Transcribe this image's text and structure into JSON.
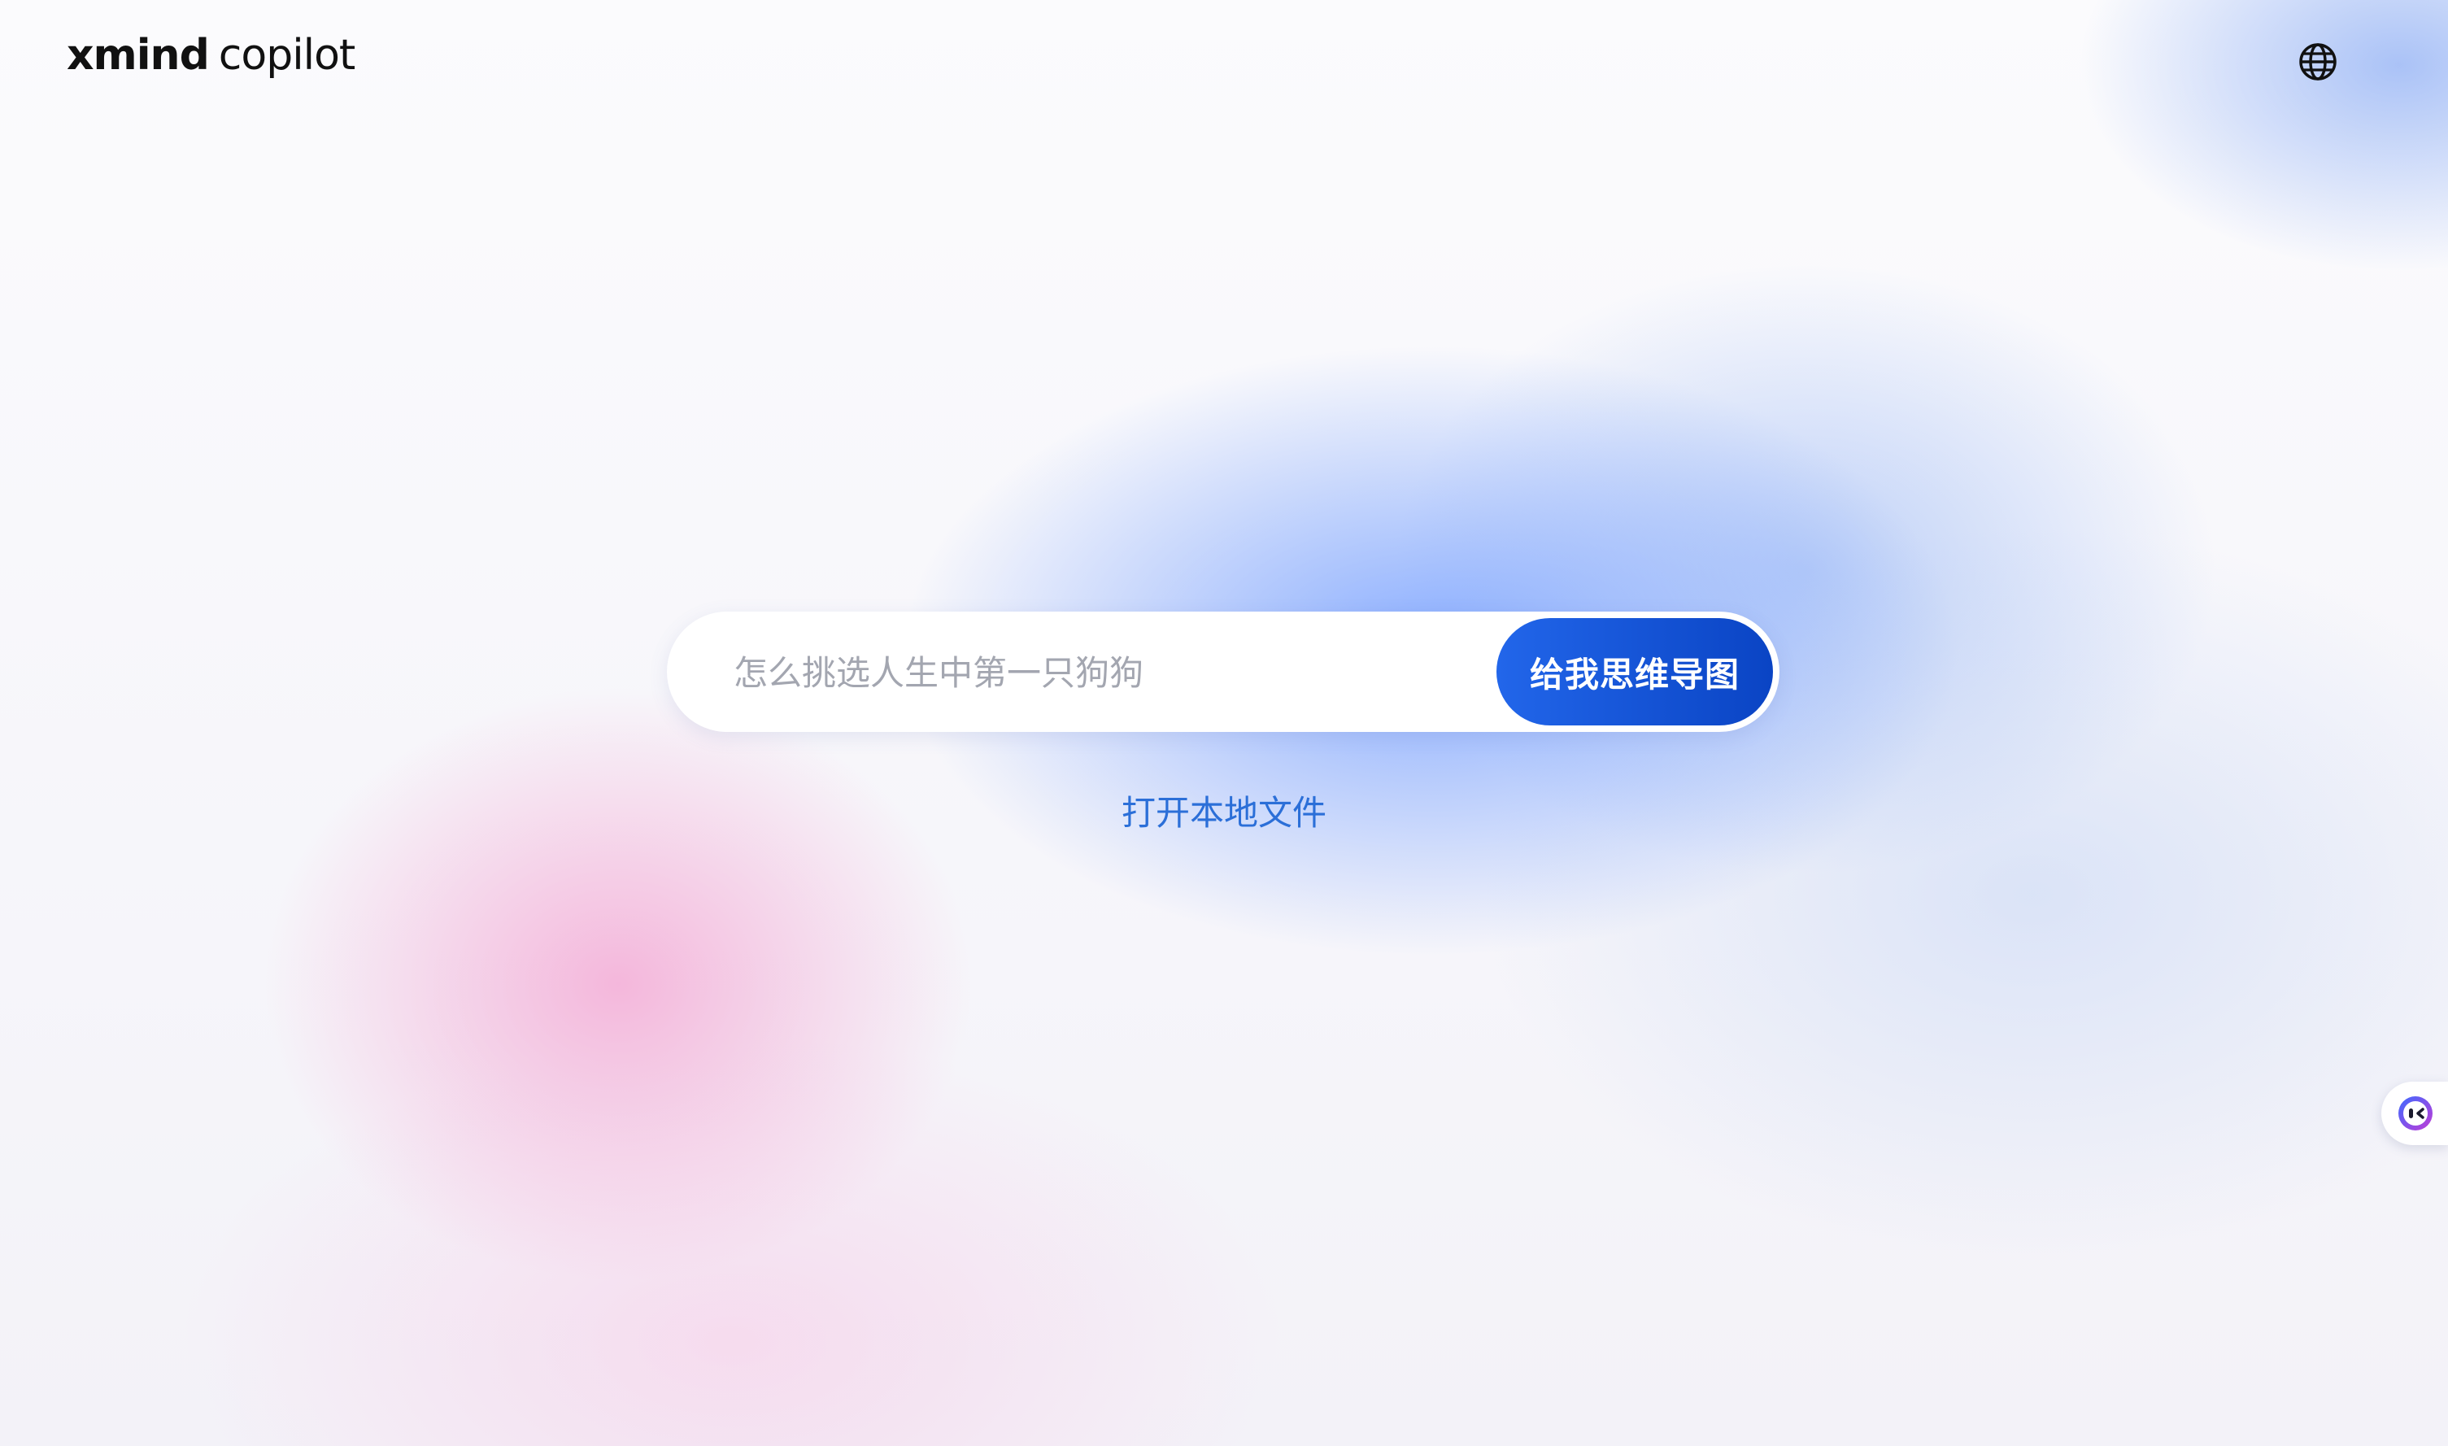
{
  "header": {
    "logo_brand": "xmind",
    "logo_product": "copilot",
    "language_icon": "globe-icon"
  },
  "search": {
    "placeholder": "怎么挑选人生中第一只狗狗",
    "value": "",
    "submit_label": "给我思维导图"
  },
  "links": {
    "open_local_file": "打开本地文件"
  },
  "assistant": {
    "icon": "robot-face-icon"
  },
  "colors": {
    "accent": "#1a57db",
    "link": "#2b6fd8",
    "background_pink": "#f4acd6",
    "background_blue": "#76a0ff"
  }
}
